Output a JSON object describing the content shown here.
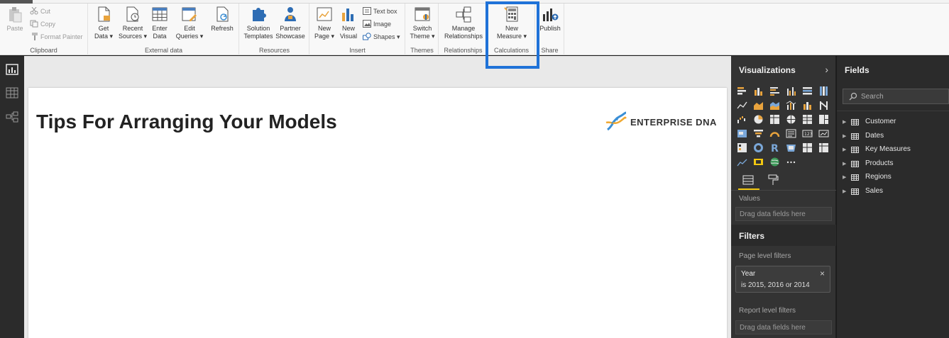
{
  "ribbon": {
    "clipboard": {
      "paste": "Paste",
      "cut": "Cut",
      "copy": "Copy",
      "format_painter": "Format Painter",
      "group": "Clipboard"
    },
    "external_data": {
      "get_data": [
        "Get",
        "Data ▾"
      ],
      "recent_sources": [
        "Recent",
        "Sources ▾"
      ],
      "enter_data": [
        "Enter",
        "Data"
      ],
      "edit_queries": [
        "Edit",
        "Queries ▾"
      ],
      "refresh": "Refresh",
      "group": "External data"
    },
    "resources": {
      "solution_templates": [
        "Solution",
        "Templates"
      ],
      "partner_showcase": [
        "Partner",
        "Showcase"
      ],
      "group": "Resources"
    },
    "insert": {
      "new_page": [
        "New",
        "Page ▾"
      ],
      "new_visual": [
        "New",
        "Visual"
      ],
      "text_box": "Text box",
      "image": "Image",
      "shapes": "Shapes ▾",
      "group": "Insert"
    },
    "themes": {
      "switch_theme": [
        "Switch",
        "Theme ▾"
      ],
      "group": "Themes"
    },
    "relationships": {
      "manage": [
        "Manage",
        "Relationships"
      ],
      "group": "Relationships"
    },
    "calculations": {
      "new_measure": [
        "New",
        "Measure ▾"
      ],
      "group": "Calculations"
    },
    "share": {
      "publish": "Publish",
      "group": "Share"
    }
  },
  "canvas": {
    "title": "Tips For Arranging Your Models",
    "logo_text": "ENTERPRISE DNA"
  },
  "visualizations": {
    "title": "Visualizations",
    "values_label": "Values",
    "values_drop": "Drag data fields here"
  },
  "filters": {
    "title": "Filters",
    "page_level": "Page level filters",
    "card": {
      "field": "Year",
      "value": "is 2015, 2016 or 2014"
    },
    "report_level": "Report level filters",
    "report_drop": "Drag data fields here"
  },
  "fields": {
    "title": "Fields",
    "search_placeholder": "Search",
    "tables": [
      "Customer",
      "Dates",
      "Key Measures",
      "Products",
      "Regions",
      "Sales"
    ]
  },
  "colors": {
    "highlight": "#1f72d8",
    "accent_yellow": "#f2c811",
    "pane_dark": "#333333",
    "logo_blue": "#3a8fd6"
  }
}
